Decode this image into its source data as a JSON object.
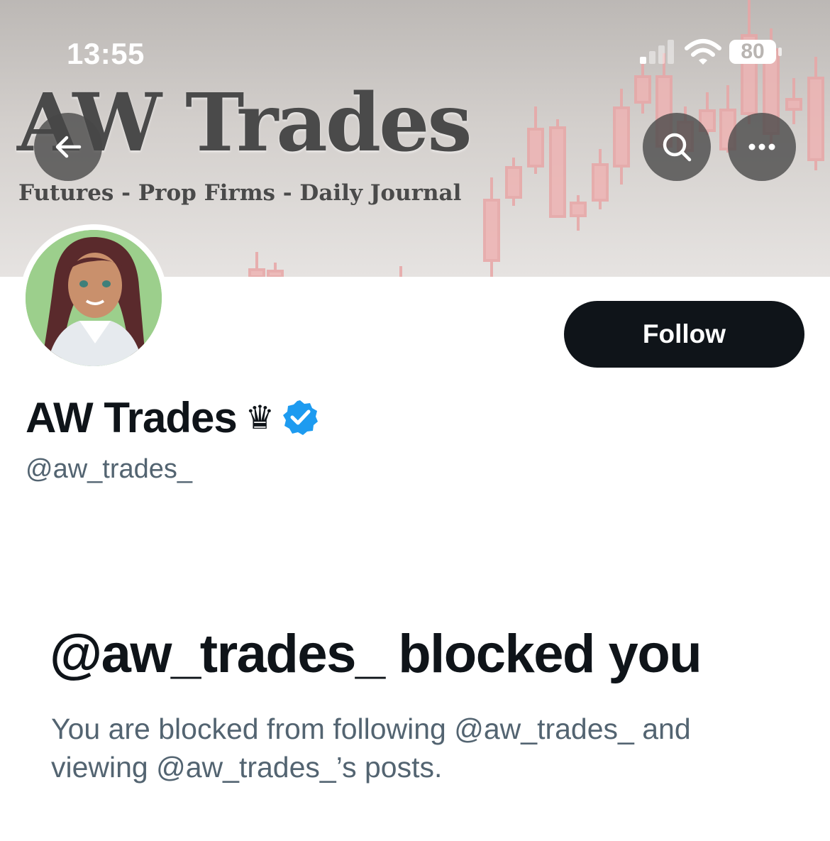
{
  "status_bar": {
    "time": "13:55",
    "battery": "80"
  },
  "banner": {
    "title": "AW Trades",
    "subtitle": "Futures - Prop Firms - Daily Journal"
  },
  "nav": {
    "back_icon": "arrow-left-icon",
    "search_icon": "search-icon",
    "more_icon": "more-horizontal-icon"
  },
  "profile": {
    "display_name": "AW Trades",
    "crown": "♛",
    "handle": "@aw_trades_",
    "verified_color": "#1d9bf0"
  },
  "actions": {
    "follow_label": "Follow"
  },
  "blocked": {
    "title": "@aw_trades_ blocked you",
    "description": "You are blocked from following @aw_trades_ and viewing @aw_trades_’s posts."
  },
  "colors": {
    "primary_text": "#0f1419",
    "secondary_text": "#536471",
    "accent": "#1d9bf0"
  }
}
